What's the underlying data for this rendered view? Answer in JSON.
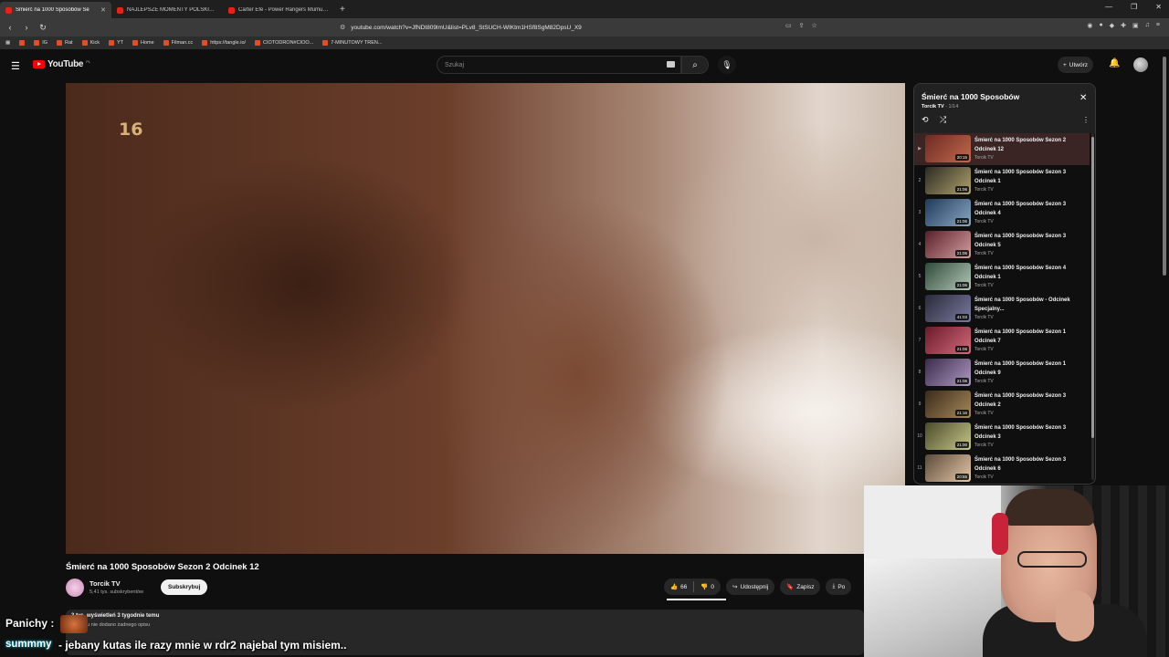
{
  "browser": {
    "tabs": [
      {
        "title": "Śmierć na 1000 Sposobów Se",
        "active": true
      },
      {
        "title": "NAJLEPSZE MOMENTY POLSKIEGO",
        "active": false
      },
      {
        "title": "Carter Efe - Power Rangers Mumu Fi",
        "active": false
      }
    ],
    "url": "youtube.com/watch?v=JfNDt809lmU&list=PLv8_StSUCH-WIKtm1HSf8SgM82DpsU_X9",
    "bookmarks": [
      "IG",
      "Rat",
      "Kick",
      "YT",
      "Home",
      "Filman.cc",
      "https://tangle.io/",
      "CIOTODRON#CIOO...",
      "7-MINUTOWY TREN..."
    ]
  },
  "youtube": {
    "logo": "YouTube",
    "region": "PL",
    "search_placeholder": "Szukaj",
    "create_label": "Utwórz"
  },
  "video": {
    "rating_badge": "16",
    "title": "Śmierć na 1000 Sposobów Sezon 2 Odcinek 12",
    "channel": "Torcik TV",
    "subscribers": "5,41 tys. subskrybentów",
    "subscribe_label": "Subskrybuj",
    "likes": "66",
    "dislikes": "0",
    "share_label": "Udostępnij",
    "save_label": "Zapisz",
    "download_label": "Po",
    "views_line": "3 tys. wyświetleń  3 tygodnie temu",
    "description": "Do filmu nie dodano żadnego opisu"
  },
  "playlist": {
    "title": "Śmierć na 1000 Sposobów",
    "owner": "Torcik TV",
    "position": "1/14",
    "items": [
      {
        "idx": "▶",
        "title": "Śmierć na 1000 Sposobów Sezon 2 Odcinek 12",
        "channel": "Torcik TV",
        "duration": "20:15",
        "current": true
      },
      {
        "idx": "2",
        "title": "Śmierć na 1000 Sposobów Sezon 3 Odcinek 1",
        "channel": "Torcik TV",
        "duration": "21:06"
      },
      {
        "idx": "3",
        "title": "Śmierć na 1000 Sposobów Sezon 3 Odcinek 4",
        "channel": "Torcik TV",
        "duration": "21:06"
      },
      {
        "idx": "4",
        "title": "Śmierć na 1000 Sposobów Sezon 3 Odcinek 5",
        "channel": "Torcik TV",
        "duration": "21:06"
      },
      {
        "idx": "5",
        "title": "Śmierć na 1000 Sposobów Sezon 4 Odcinek 1",
        "channel": "Torcik TV",
        "duration": "21:06"
      },
      {
        "idx": "6",
        "title": "Śmierć na 1000 Sposobów - Odcinek Specjalny...",
        "channel": "Torcik TV",
        "duration": "41:03"
      },
      {
        "idx": "7",
        "title": "Śmierć na 1000 Sposobów Sezon 1 Odcinek 7",
        "channel": "Torcik TV",
        "duration": "21:06"
      },
      {
        "idx": "8",
        "title": "Śmierć na 1000 Sposobów Sezon 1 Odcinek 9",
        "channel": "Torcik TV",
        "duration": "21:06"
      },
      {
        "idx": "9",
        "title": "Śmierć na 1000 Sposobów Sezon 3 Odcinek 2",
        "channel": "Torcik TV",
        "duration": "21:16"
      },
      {
        "idx": "10",
        "title": "Śmierć na 1000 Sposobów Sezon 3 Odcinek 3",
        "channel": "Torcik TV",
        "duration": "21:00"
      },
      {
        "idx": "11",
        "title": "Śmierć na 1000 Sposobów Sezon 3 Odcinek 6",
        "channel": "Torcik TV",
        "duration": "20:55"
      }
    ]
  },
  "chat": {
    "line1_user": "Panichy :",
    "line2_user": "summmy",
    "line2_message": "- jebany kutas ile razy mnie w rdr2 najebal tym misiem.."
  },
  "colors": {
    "yt_red": "#ff0000",
    "background": "#0f0f0f",
    "playlist_current": "#3a2424"
  }
}
